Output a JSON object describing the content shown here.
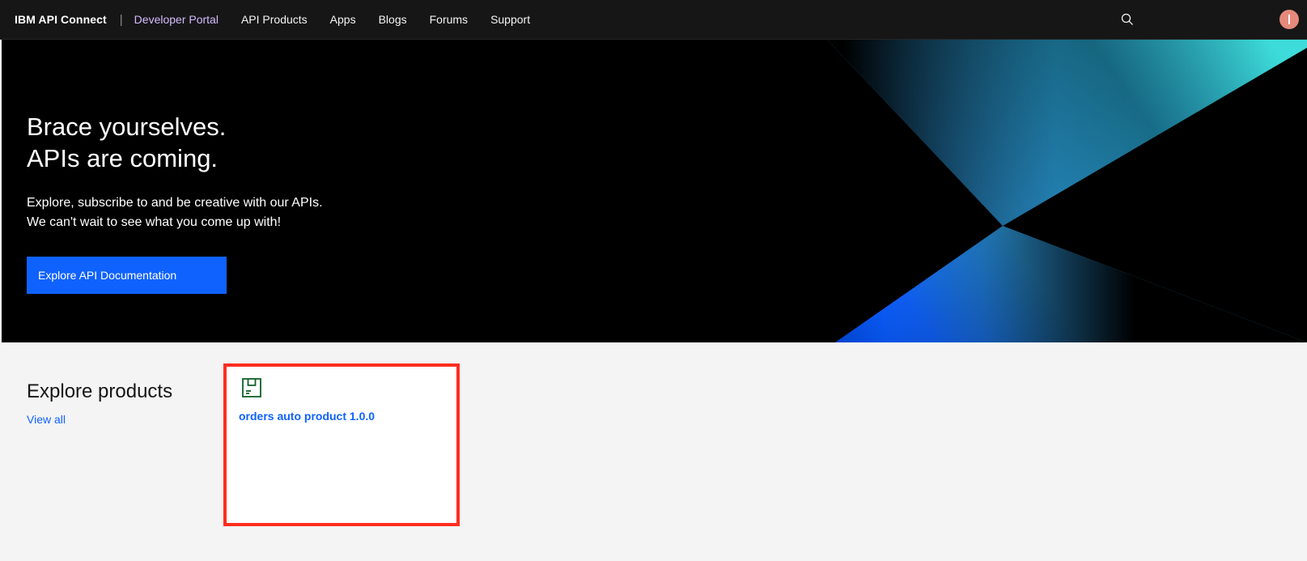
{
  "header": {
    "brand": "IBM API Connect",
    "separator": "|",
    "portal_name": "Developer Portal",
    "nav_items": [
      "API Products",
      "Apps",
      "Blogs",
      "Forums",
      "Support"
    ]
  },
  "hero": {
    "title_line1": "Brace yourselves.",
    "title_line2": "APIs are coming.",
    "subtitle_line1": "Explore, subscribe to and be creative with our APIs.",
    "subtitle_line2": "We can't wait to see what you come up with!",
    "button_label": "Explore API Documentation"
  },
  "products": {
    "section_title": "Explore products",
    "view_all_label": "View all",
    "items": [
      {
        "name": "orders auto product 1.0.0",
        "icon": "product-icon"
      }
    ]
  },
  "colors": {
    "accent": "#0f62fe",
    "highlight": "#ff2d1f",
    "portal_purple": "#d4bbff"
  }
}
